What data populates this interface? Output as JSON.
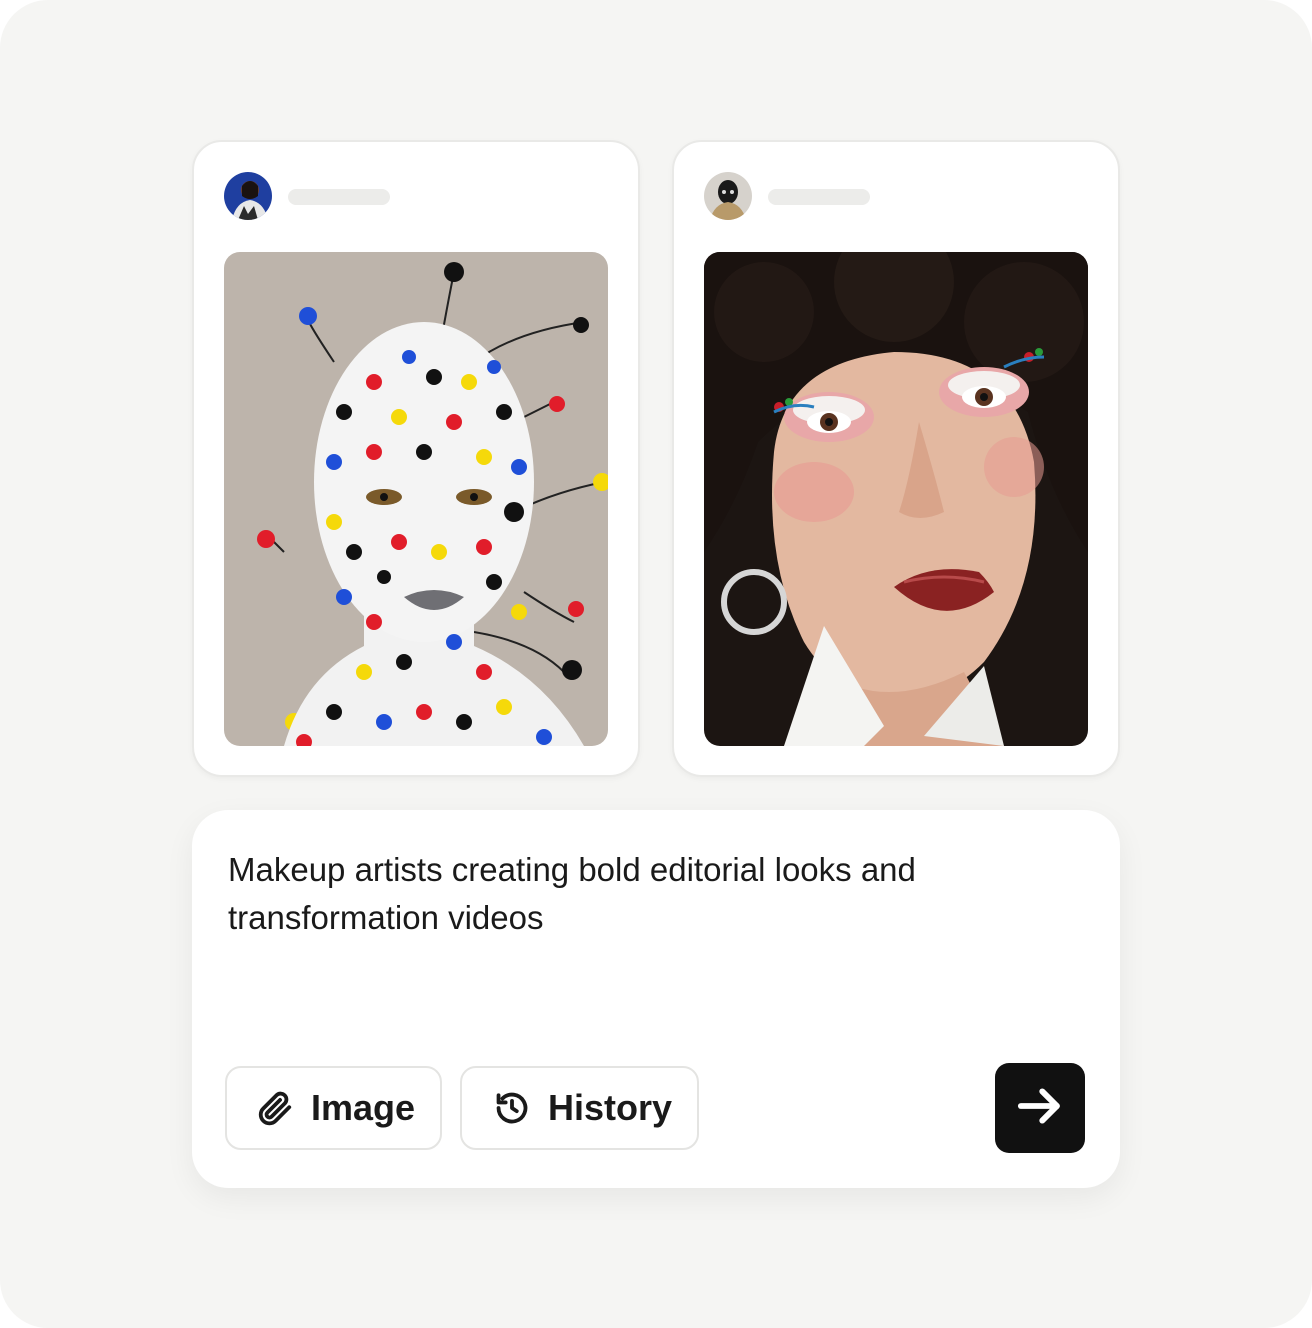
{
  "posts": [
    {
      "avatar_icon": "user-avatar-photo",
      "photo_icon": "polka-dot-body-paint-portrait",
      "accent_colors": [
        "#e11d2a",
        "#1f4fd8",
        "#f5d90a",
        "#111111"
      ]
    },
    {
      "avatar_icon": "user-avatar-photo",
      "photo_icon": "editorial-eye-makeup-portrait",
      "accent_colors": [
        "#2a1a14",
        "#d98a7a",
        "#8a2020"
      ]
    }
  ],
  "prompt": {
    "text": "Makeup artists creating bold editorial looks and transformation videos"
  },
  "actions": {
    "image_label": "Image",
    "image_icon": "paperclip-icon",
    "history_label": "History",
    "history_icon": "history-clock-icon",
    "send_icon": "arrow-right-icon"
  }
}
